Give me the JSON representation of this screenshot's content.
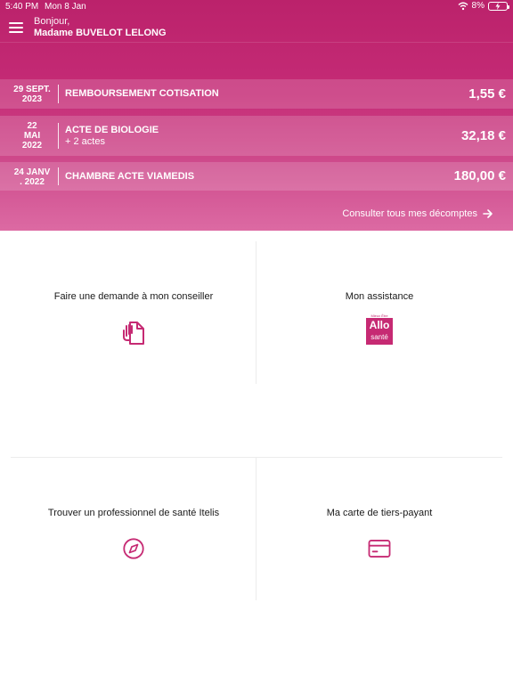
{
  "status_bar": {
    "time": "5:40 PM",
    "date": "Mon 8 Jan",
    "battery": "8%"
  },
  "header": {
    "greeting": "Bonjour,",
    "user_name": "Madame BUVELOT LELONG"
  },
  "reimbursements": [
    {
      "date_line1": "29 SEPT.",
      "date_line2": "2023",
      "date_line3": "",
      "title": "REMBOURSEMENT COTISATION",
      "subtitle": "",
      "amount": "1,55 €"
    },
    {
      "date_line1": "22",
      "date_line2": "MAI",
      "date_line3": "2022",
      "title": "ACTE DE BIOLOGIE",
      "subtitle": "+ 2 actes",
      "amount": "32,18 €"
    },
    {
      "date_line1": "24 JANV",
      "date_line2": ". 2022",
      "date_line3": "",
      "title": "CHAMBRE ACTE VIAMEDIS",
      "subtitle": "",
      "amount": "180,00 €"
    }
  ],
  "see_all_label": "Consulter tous mes décomptes",
  "tiles": {
    "advisor": {
      "label": "Faire une demande à mon conseiller",
      "icon": "document-hand-icon"
    },
    "assistance": {
      "label": "Mon assistance",
      "icon": "allo-sante-logo",
      "logo_top": "Mieux Être",
      "logo_main": "Allo",
      "logo_sub": "santé"
    },
    "professional": {
      "label": "Trouver un professionnel de santé Itelis",
      "icon": "compass-icon"
    },
    "card": {
      "label": "Ma carte de tiers-payant",
      "icon": "card-icon"
    }
  },
  "colors": {
    "brand": "#c62a73",
    "header_top": "#bb226b",
    "header_bottom": "#dc6aa3"
  }
}
